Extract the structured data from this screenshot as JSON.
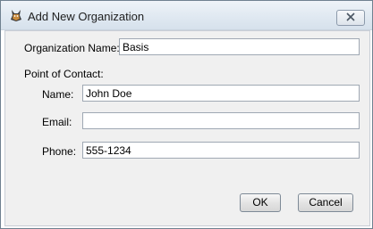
{
  "window": {
    "title": "Add New Organization",
    "icon": "app-logo-icon",
    "close_icon": "close-icon"
  },
  "form": {
    "org_name_label": "Organization Name:",
    "org_name_value": "Basis",
    "contact_section_label": "Point of Contact:",
    "name_label": "Name:",
    "name_value": "John Doe",
    "email_label": "Email:",
    "email_value": "",
    "phone_label": "Phone:",
    "phone_value": "555-1234"
  },
  "buttons": {
    "ok_label": "OK",
    "cancel_label": "Cancel"
  }
}
